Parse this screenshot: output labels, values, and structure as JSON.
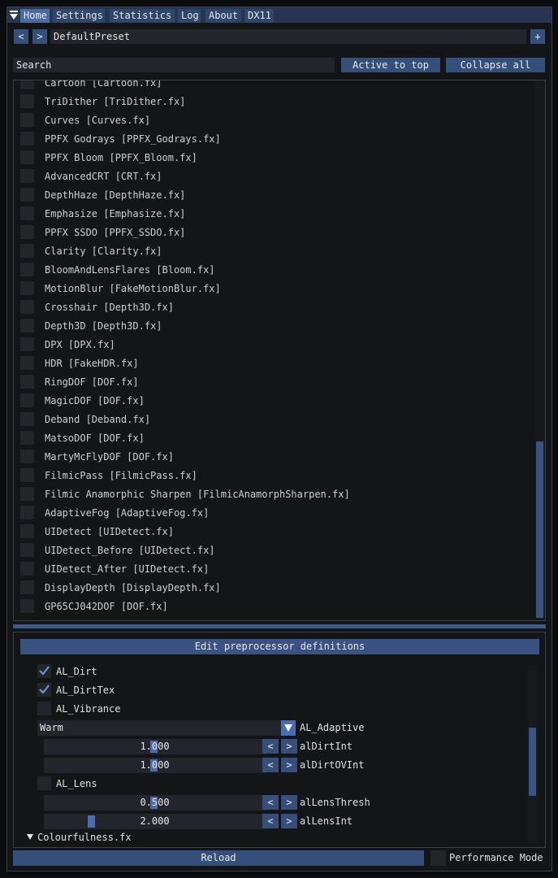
{
  "tabs": [
    "Home",
    "Settings",
    "Statistics",
    "Log",
    "About",
    "DX11"
  ],
  "preset": {
    "prev": "<",
    "next": ">",
    "name": "DefaultPreset",
    "add": "+"
  },
  "search": {
    "value": "Search"
  },
  "buttons": {
    "active_to_top": "Active to top",
    "collapse_all": "Collapse all"
  },
  "effects": [
    "Cartoon [Cartoon.fx]",
    "TriDither [TriDither.fx]",
    "Curves [Curves.fx]",
    "PPFX Godrays [PPFX_Godrays.fx]",
    "PPFX Bloom [PPFX_Bloom.fx]",
    "AdvancedCRT [CRT.fx]",
    "DepthHaze [DepthHaze.fx]",
    "Emphasize [Emphasize.fx]",
    "PPFX SSDO [PPFX_SSDO.fx]",
    "Clarity [Clarity.fx]",
    "BloomAndLensFlares [Bloom.fx]",
    "MotionBlur [FakeMotionBlur.fx]",
    "Crosshair [Depth3D.fx]",
    "Depth3D [Depth3D.fx]",
    "DPX [DPX.fx]",
    "HDR [FakeHDR.fx]",
    "RingDOF [DOF.fx]",
    "MagicDOF [DOF.fx]",
    "Deband [Deband.fx]",
    "MatsoDOF [DOF.fx]",
    "MartyMcFlyDOF [DOF.fx]",
    "FilmicPass [FilmicPass.fx]",
    "Filmic Anamorphic Sharpen [FilmicAnamorphSharpen.fx]",
    "AdaptiveFog [AdaptiveFog.fx]",
    "UIDetect [UIDetect.fx]",
    "UIDetect_Before [UIDetect.fx]",
    "UIDetect_After [UIDetect.fx]",
    "DisplayDepth [DisplayDepth.fx]",
    "GP65CJ042DOF [DOF.fx]"
  ],
  "preprocessor": {
    "header": "Edit preprocessor definitions",
    "al_dirt": {
      "label": "AL_Dirt",
      "checked": true
    },
    "al_dirttex": {
      "label": "AL_DirtTex",
      "checked": true
    },
    "al_vibrance": {
      "label": "AL_Vibrance",
      "checked": false
    },
    "al_adaptive": {
      "label": "AL_Adaptive",
      "value": "Warm"
    },
    "aldirtint": {
      "label": "alDirtInt",
      "value": "1.000"
    },
    "aldirtovint": {
      "label": "alDirtOVInt",
      "value": "1.000"
    },
    "al_lens": {
      "label": "AL_Lens",
      "checked": false
    },
    "allensthresh": {
      "label": "alLensThresh",
      "value": "0.500"
    },
    "allensint": {
      "label": "alLensInt",
      "value": "2.000"
    },
    "section": "Colourfulness.fx",
    "dec": "<",
    "inc": ">"
  },
  "footer": {
    "reload": "Reload",
    "performance_mode": "Performance Mode"
  }
}
